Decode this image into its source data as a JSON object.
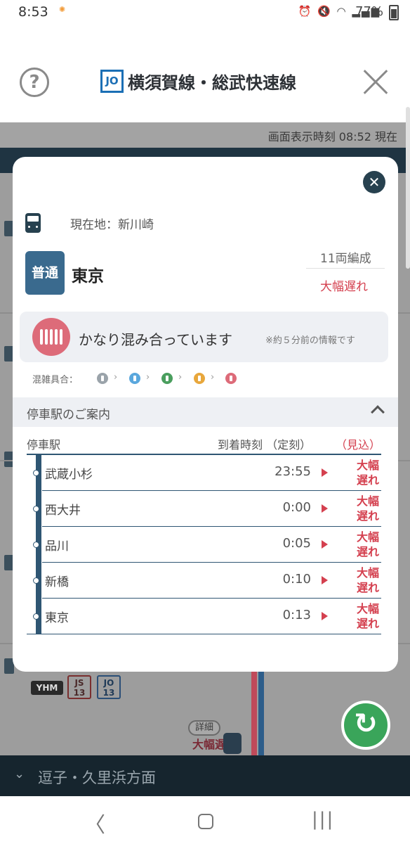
{
  "status_bar": {
    "time": "8:53",
    "battery_pct": "77%",
    "icons": [
      "alarm-icon",
      "mute-icon",
      "wifi-icon",
      "signal-icon",
      "battery-icon"
    ]
  },
  "header": {
    "line_code": "JO",
    "line_name": "横須賀線・総武快速線",
    "help_icon": "?",
    "close_icon": "✕"
  },
  "background": {
    "display_time": "画面表示時刻 08:52 現在",
    "yhm": "YHM",
    "js_code": "JS 13",
    "jo_code": "JO 13",
    "detail": "詳細",
    "delay": "大幅遅れ",
    "direction": "逗子・久里浜方面"
  },
  "modal": {
    "close_icon": "✕",
    "current_location": "現在地：新川崎",
    "train_type": "普通",
    "destination": "東京",
    "cars": "11両編成",
    "delay_status": "大幅遅れ",
    "crowd_text": "かなり混み合っています",
    "crowd_note": "※約５分前の情報です",
    "crowd_scale_label": "混雑具合：",
    "crowd_scale_colors": [
      "#9aa3aa",
      "#5aa7dd",
      "#4a9e5e",
      "#e8a73c",
      "#dd6b79"
    ],
    "stops_title": "停車駅のご案内",
    "columns": {
      "station": "停車駅",
      "arrival": "到着時刻 （定刻）",
      "estimate": "（見込）"
    },
    "stops": [
      {
        "name": "武蔵小杉",
        "time": "23:55",
        "status": "大幅遅れ"
      },
      {
        "name": "西大井",
        "time": "0:00",
        "status": "大幅遅れ"
      },
      {
        "name": "品川",
        "time": "0:05",
        "status": "大幅遅れ"
      },
      {
        "name": "新橋",
        "time": "0:10",
        "status": "大幅遅れ"
      },
      {
        "name": "東京",
        "time": "0:13",
        "status": "大幅遅れ"
      }
    ]
  },
  "navbar": {
    "back": "〈",
    "recent": "|||"
  },
  "colors": {
    "accent_navy": "#27414f",
    "line_blue": "#1b6fb5",
    "delay_red": "#d4404f",
    "crowd_pink": "#dd6b79",
    "refresh_green": "#3aa55a"
  }
}
